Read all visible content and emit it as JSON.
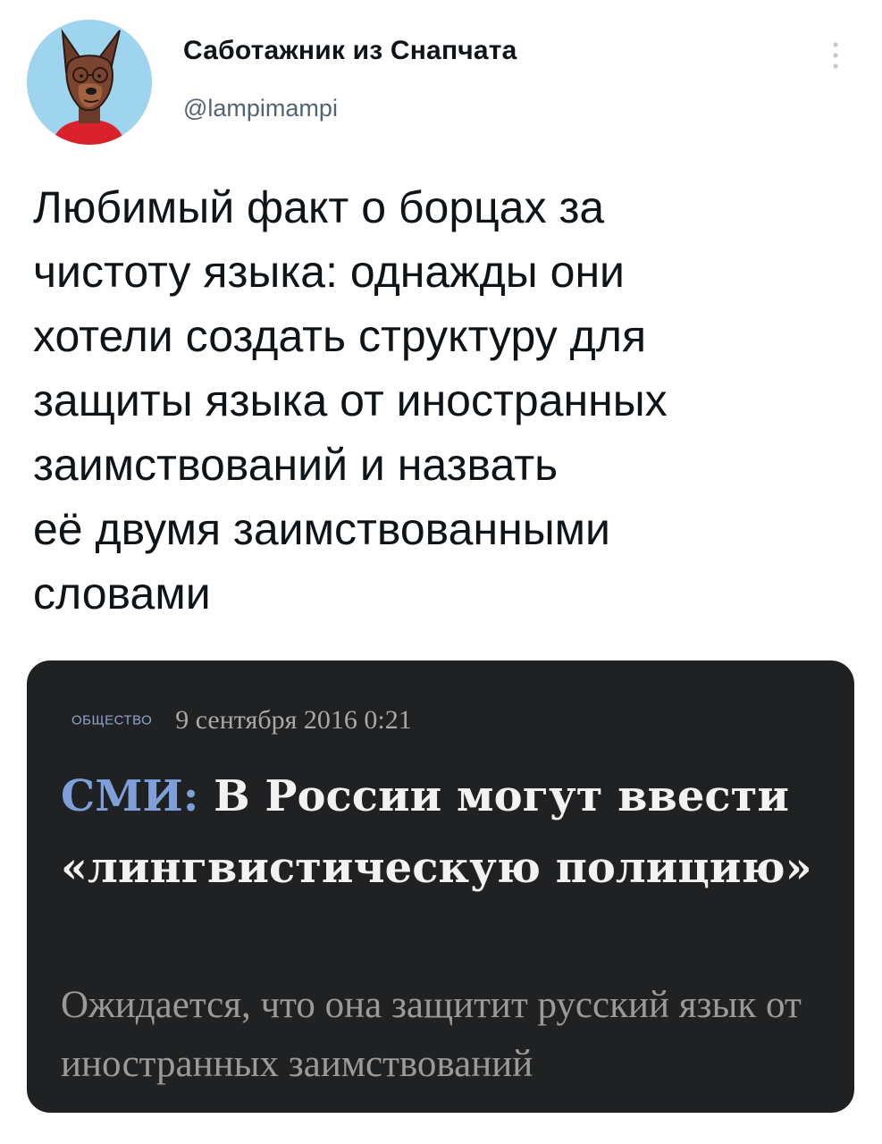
{
  "tweet": {
    "author": {
      "display_name": "Саботажник из Снапчата",
      "handle": "@lampimampi",
      "avatar_icon": "dog-avatar-icon"
    },
    "more_icon": "more-vertical-icon",
    "text": "Любимый факт о борцах за\nчистоту языка: однажды они\nхотели создать структуру для\nзащиты языка от иностранных\nзаимствований и назвать\nеё двумя заимствованными\nсловами"
  },
  "news_card": {
    "rubric": "ОБЩЕСТВО",
    "date": "9 сентября 2016 0:21",
    "headline_source": "СМИ:",
    "headline": " В России могут ввести «лингвистическую полицию»",
    "lead": "Ожидается, что она защитит русский язык от иностранных заимствований"
  },
  "colors": {
    "card_background": "#1f2123",
    "headline_accent": "#7f9fd9",
    "avatar_background": "#9fd4ee",
    "handle_text": "#536471"
  }
}
